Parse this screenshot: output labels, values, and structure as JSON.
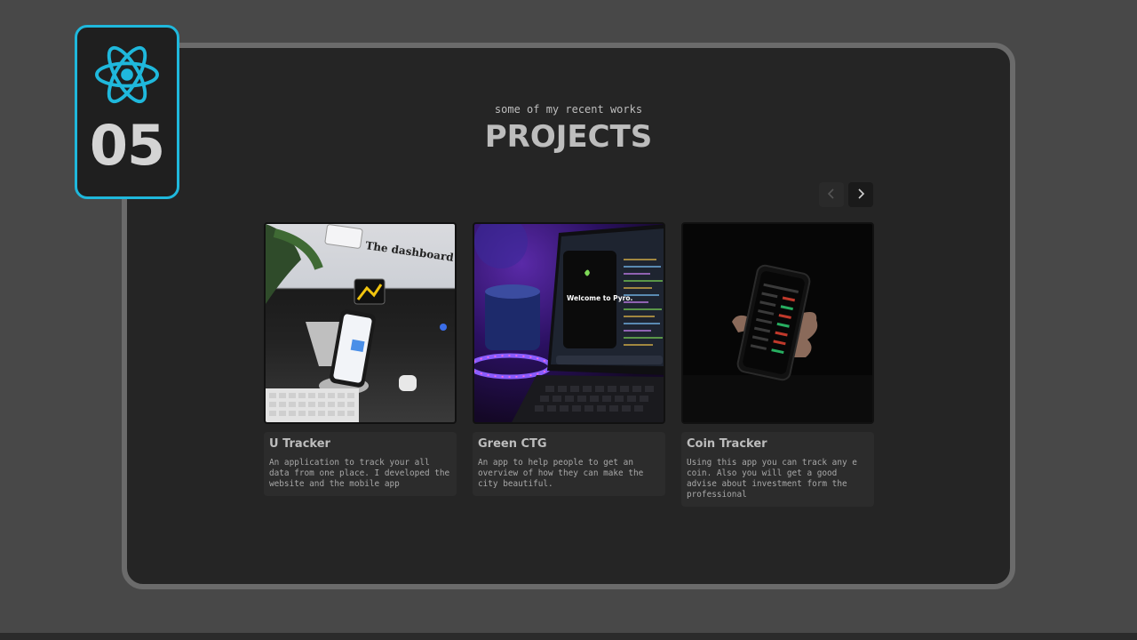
{
  "badge": {
    "number": "05",
    "icon": "react-icon",
    "accent": "#1fb8dc"
  },
  "section": {
    "subtitle": "some of my recent works",
    "title": "PROJECTS"
  },
  "nav": {
    "prev": "chevron-left-icon",
    "next": "chevron-right-icon"
  },
  "projects": [
    {
      "name": "U Tracker",
      "description": "An application to track your all data from one place. I developed the website and the mobile app",
      "image_text": "The dashboard"
    },
    {
      "name": "Green CTG",
      "description": "An app to help people to get an overview of how they can make the city beautiful.",
      "image_text": "Welcome to Pyro."
    },
    {
      "name": "Coin Tracker",
      "description": "Using this app you can track any e coin. Also you will get a good advise about investment form the professional"
    }
  ]
}
